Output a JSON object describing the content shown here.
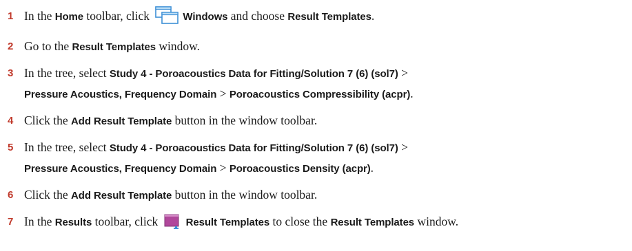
{
  "steps": [
    {
      "num": "1",
      "t1": "In the ",
      "b1": "Home",
      "t2": " toolbar, click ",
      "icon": "windows-icon",
      "b2": "Windows",
      "t3": " and choose ",
      "b3": "Result Templates",
      "t4": "."
    },
    {
      "num": "2",
      "t1": "Go to the ",
      "b1": "Result Templates",
      "t2": " window."
    },
    {
      "num": "3",
      "t1": "In the tree, select ",
      "b1": "Study 4 - Poroacoustics Data for Fitting/Solution 7 (6) (sol7)",
      "t2": " >",
      "b2": "Pressure Acoustics, Frequency Domain",
      "t3": " > ",
      "b3": "Poroacoustics Compressibility (acpr)",
      "t4": "."
    },
    {
      "num": "4",
      "t1": "Click the ",
      "b1": "Add Result Template",
      "t2": " button in the window toolbar."
    },
    {
      "num": "5",
      "t1": "In the tree, select ",
      "b1": "Study 4 - Poroacoustics Data for Fitting/Solution 7 (6) (sol7)",
      "t2": " >",
      "b2": "Pressure Acoustics, Frequency Domain",
      "t3": " > ",
      "b3": "Poroacoustics Density (acpr)",
      "t4": "."
    },
    {
      "num": "6",
      "t1": "Click the ",
      "b1": "Add Result Template",
      "t2": " button in the window toolbar."
    },
    {
      "num": "7",
      "t1": "In the ",
      "b1": "Results",
      "t2": " toolbar, click ",
      "icon": "result-templates-icon",
      "b2": "Result Templates",
      "t3": " to close the ",
      "b3": "Result Templates",
      "t4": " window."
    }
  ],
  "colors": {
    "step_number": "#c0392b",
    "windows_icon_frame": "#3d8fd6",
    "result_templates_icon": "#b0479b"
  }
}
